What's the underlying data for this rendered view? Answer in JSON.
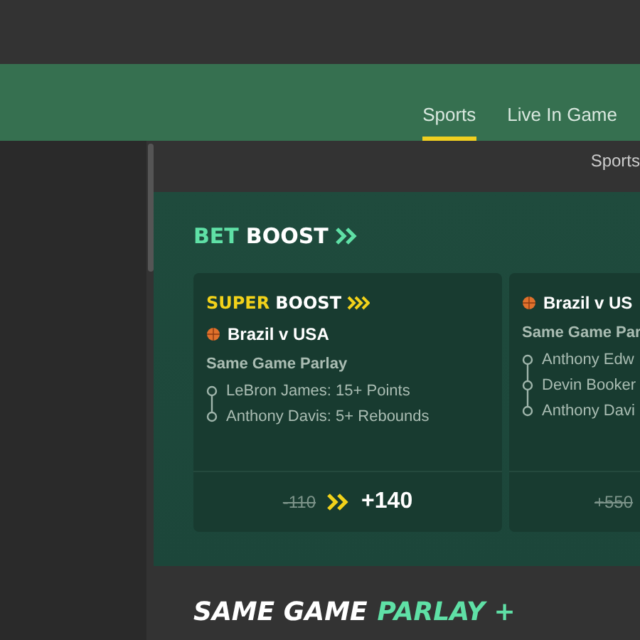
{
  "top_nav": {
    "tabs": [
      {
        "label": "Sports",
        "selected": true
      },
      {
        "label": "Live In Game",
        "selected": false
      }
    ]
  },
  "breadcrumb": "Sports",
  "bet_boost": {
    "title_accent": "BET",
    "title": "BOOST",
    "cards": [
      {
        "badge_accent": "SUPER",
        "badge": "BOOST",
        "match": "Brazil v USA",
        "market": "Same Game Parlay",
        "legs": [
          "LeBron James: 15+ Points",
          "Anthony Davis: 5+ Rebounds"
        ],
        "old_odds": "-110",
        "new_odds": "+140"
      },
      {
        "match": "Brazil v US",
        "market": "Same Game Par",
        "legs": [
          "Anthony Edw",
          "Devin Booker",
          "Anthony Davi"
        ],
        "old_odds": "+550"
      }
    ]
  },
  "same_game_parlay": {
    "title": "SAME GAME",
    "title_accent": "PARLAY +"
  }
}
